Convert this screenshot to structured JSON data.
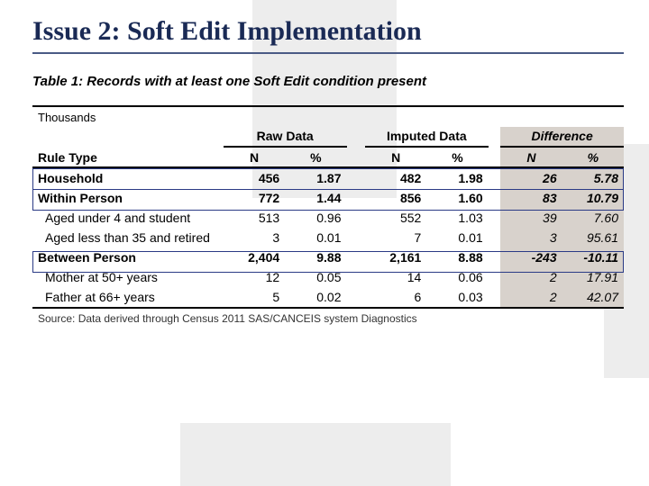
{
  "title": "Issue 2: Soft Edit Implementation",
  "caption": "Table 1: Records with at least one Soft Edit condition present",
  "unit_label": "Thousands",
  "groups": {
    "raw": "Raw Data",
    "imputed": "Imputed Data",
    "diff": "Difference"
  },
  "sub": {
    "rule": "Rule Type",
    "n": "N",
    "pct": "%"
  },
  "source": "Source: Data derived through Census 2011 SAS/CANCEIS system Diagnostics",
  "chart_data": {
    "type": "table",
    "title": "Records with at least one Soft Edit condition present",
    "unit": "Thousands",
    "columns": [
      "Rule Type",
      "Raw N",
      "Raw %",
      "Imputed N",
      "Imputed %",
      "Diff N",
      "Diff %"
    ],
    "rows": [
      {
        "rule": "Household",
        "bold": true,
        "raw_n": "456",
        "raw_p": "1.87",
        "imp_n": "482",
        "imp_p": "1.98",
        "d_n": "26",
        "d_p": "5.78"
      },
      {
        "rule": "Within Person",
        "bold": true,
        "raw_n": "772",
        "raw_p": "1.44",
        "imp_n": "856",
        "imp_p": "1.60",
        "d_n": "83",
        "d_p": "10.79"
      },
      {
        "rule": "Aged under 4 and student",
        "bold": false,
        "raw_n": "513",
        "raw_p": "0.96",
        "imp_n": "552",
        "imp_p": "1.03",
        "d_n": "39",
        "d_p": "7.60"
      },
      {
        "rule": "Aged less than 35 and retired",
        "bold": false,
        "raw_n": "3",
        "raw_p": "0.01",
        "imp_n": "7",
        "imp_p": "0.01",
        "d_n": "3",
        "d_p": "95.61"
      },
      {
        "rule": "Between Person",
        "bold": true,
        "raw_n": "2,404",
        "raw_p": "9.88",
        "imp_n": "2,161",
        "imp_p": "8.88",
        "d_n": "-243",
        "d_p": "-10.11"
      },
      {
        "rule": "Mother at 50+ years",
        "bold": false,
        "raw_n": "12",
        "raw_p": "0.05",
        "imp_n": "14",
        "imp_p": "0.06",
        "d_n": "2",
        "d_p": "17.91"
      },
      {
        "rule": "Father at 66+ years",
        "bold": false,
        "raw_n": "5",
        "raw_p": "0.02",
        "imp_n": "6",
        "imp_p": "0.03",
        "d_n": "2",
        "d_p": "42.07"
      }
    ]
  }
}
